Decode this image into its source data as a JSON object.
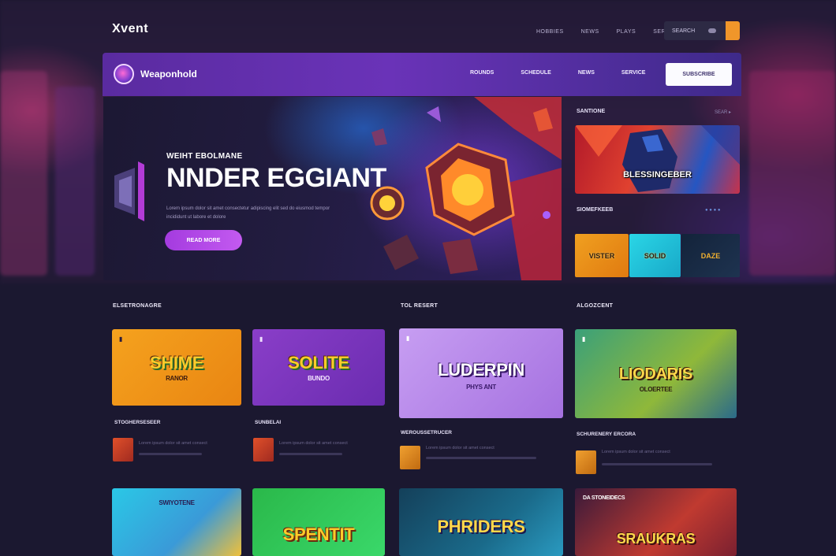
{
  "outer": {
    "logo": "Xvent",
    "nav": [
      "HOBBIES",
      "NEWS",
      "PLAYS",
      "SERVICES"
    ],
    "search_label": "SEARCH"
  },
  "frame": {
    "brand": "Weaponhold",
    "nav": [
      "ROUNDS",
      "SCHEDULE",
      "NEWS",
      "SERVICE"
    ],
    "cta": "SUBSCRIBE"
  },
  "hero": {
    "kicker": "WEIHT EBOLMANE",
    "title": "NNDER EGGIANT",
    "desc": "Lorem ipsum dolor sit amet consectetur adipiscing elit sed do eiusmod tempor incididunt ut labore et dolore",
    "button": "READ MORE"
  },
  "sidebar": {
    "top_label": "SANTIONE",
    "top_meta": "SEAR ▸",
    "banner_caption": "BLESSINGEBER",
    "mid_label": "SIOMEFKEEB",
    "mid_meta": "● ● ● ●",
    "thumbs": [
      "VISTER",
      "SOLID",
      "DAZE"
    ]
  },
  "sections": {
    "left": "ELSETRONAGRE",
    "middle": "TOL RESERT",
    "right": "ALGOZCENT"
  },
  "cards_row1": [
    {
      "logo": "SHIME",
      "sub": "RANOR",
      "title": "STOGHERSESEER"
    },
    {
      "logo": "SOLITE",
      "sub": "BUNDO",
      "title": "SUNBELAI"
    },
    {
      "logo": "LUDERPIN",
      "sub": "PHYS ANT",
      "title": "WEROUSSETRUCER"
    },
    {
      "logo": "LIODARIS",
      "sub": "OLOERTEE",
      "title": "SCHURENERY ERCORA"
    }
  ],
  "cards_row2": [
    {
      "logo": "SWIYOTENE"
    },
    {
      "logo": "SPENTIT"
    },
    {
      "logo": "PHRIDERS"
    },
    {
      "logo": "SRAUKRAS",
      "top": "DA STONEIDECS"
    }
  ],
  "meta_sample": "Lorem ipsum dolor sit amet consect"
}
